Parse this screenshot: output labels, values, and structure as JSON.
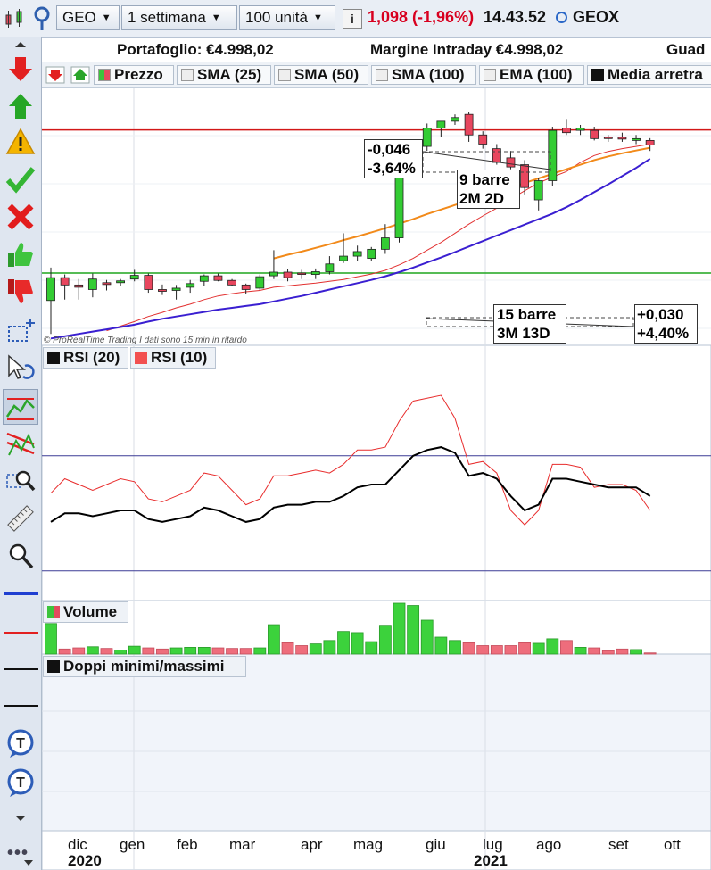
{
  "topbar": {
    "symbol": "GEO",
    "timeframe": "1 settimana",
    "units": "100 unità",
    "price_change": "1,098 (-1,96%)",
    "time": "14.43.52",
    "ticker": "GEOX"
  },
  "account": {
    "portfolio": "Portafoglio: €4.998,02",
    "margin": "Margine Intraday €4.998,02",
    "gain": "Guad"
  },
  "legend": {
    "price": "Prezzo",
    "sma25": "SMA (25)",
    "sma50": "SMA (50)",
    "sma100": "SMA (100)",
    "ema100": "EMA (100)",
    "media": "Media arretra"
  },
  "annotations": {
    "box1_line1": "-0,046",
    "box1_line2": "-3,64%",
    "box2_line1": "9 barre",
    "box2_line2": "2M 2D",
    "box3_line1": "15 barre",
    "box3_line2": "3M 13D",
    "box4_line1": "+0,030",
    "box4_line2": "+4,40%",
    "watermark": "© ProRealTime Trading  I dati sono 15 min in ritardo"
  },
  "panels": {
    "rsi20": "RSI (20)",
    "rsi10": "RSI (10)",
    "volume": "Volume",
    "doppi": "Doppi minimi/massimi"
  },
  "xaxis": {
    "months": [
      "dic",
      "gen",
      "feb",
      "mar",
      "apr",
      "mag",
      "giu",
      "lug",
      "ago",
      "set",
      "ott"
    ],
    "year_2020": "2020",
    "year_2021": "2021"
  },
  "colors": {
    "bull": "#33cc33",
    "bear": "#e8465e",
    "sma_red": "#e23030",
    "sma_orange": "#f28a1a",
    "sma_blue": "#3a1fd1",
    "rsi20": "#000000",
    "rsi10": "#e82c2c",
    "hline_red": "#d21818",
    "hline_green": "#1fa51f"
  },
  "chart_data": {
    "type": "candlestick",
    "interval": "1 settimana",
    "candles": [
      {
        "o": 0.878,
        "h": 0.95,
        "l": 0.805,
        "c": 0.928
      },
      {
        "o": 0.928,
        "h": 0.935,
        "l": 0.88,
        "c": 0.912
      },
      {
        "o": 0.912,
        "h": 0.925,
        "l": 0.88,
        "c": 0.907
      },
      {
        "o": 0.902,
        "h": 0.937,
        "l": 0.885,
        "c": 0.925
      },
      {
        "o": 0.917,
        "h": 0.923,
        "l": 0.9,
        "c": 0.913
      },
      {
        "o": 0.917,
        "h": 0.925,
        "l": 0.91,
        "c": 0.921
      },
      {
        "o": 0.925,
        "h": 0.945,
        "l": 0.92,
        "c": 0.933
      },
      {
        "o": 0.933,
        "h": 0.937,
        "l": 0.895,
        "c": 0.902
      },
      {
        "o": 0.902,
        "h": 0.913,
        "l": 0.89,
        "c": 0.898
      },
      {
        "o": 0.9,
        "h": 0.912,
        "l": 0.88,
        "c": 0.905
      },
      {
        "o": 0.907,
        "h": 0.923,
        "l": 0.895,
        "c": 0.915
      },
      {
        "o": 0.92,
        "h": 0.935,
        "l": 0.91,
        "c": 0.932
      },
      {
        "o": 0.932,
        "h": 0.937,
        "l": 0.92,
        "c": 0.922
      },
      {
        "o": 0.922,
        "h": 0.925,
        "l": 0.91,
        "c": 0.912
      },
      {
        "o": 0.912,
        "h": 0.915,
        "l": 0.892,
        "c": 0.902
      },
      {
        "o": 0.905,
        "h": 0.935,
        "l": 0.9,
        "c": 0.93
      },
      {
        "o": 0.932,
        "h": 0.988,
        "l": 0.925,
        "c": 0.94
      },
      {
        "o": 0.94,
        "h": 0.947,
        "l": 0.92,
        "c": 0.928
      },
      {
        "o": 0.938,
        "h": 0.945,
        "l": 0.925,
        "c": 0.935
      },
      {
        "o": 0.935,
        "h": 0.948,
        "l": 0.925,
        "c": 0.941
      },
      {
        "o": 0.941,
        "h": 0.975,
        "l": 0.935,
        "c": 0.958
      },
      {
        "o": 0.965,
        "h": 1.025,
        "l": 0.96,
        "c": 0.975
      },
      {
        "o": 0.975,
        "h": 0.998,
        "l": 0.965,
        "c": 0.985
      },
      {
        "o": 0.97,
        "h": 0.995,
        "l": 0.965,
        "c": 0.99
      },
      {
        "o": 0.99,
        "h": 1.045,
        "l": 0.98,
        "c": 1.015
      },
      {
        "o": 1.015,
        "h": 1.18,
        "l": 1.005,
        "c": 1.16
      },
      {
        "o": 1.16,
        "h": 1.225,
        "l": 1.15,
        "c": 1.21
      },
      {
        "o": 1.215,
        "h": 1.265,
        "l": 1.205,
        "c": 1.255
      },
      {
        "o": 1.255,
        "h": 1.27,
        "l": 1.235,
        "c": 1.27
      },
      {
        "o": 1.27,
        "h": 1.285,
        "l": 1.262,
        "c": 1.278
      },
      {
        "o": 1.285,
        "h": 1.29,
        "l": 1.225,
        "c": 1.24
      },
      {
        "o": 1.24,
        "h": 1.248,
        "l": 1.21,
        "c": 1.22
      },
      {
        "o": 1.21,
        "h": 1.22,
        "l": 1.175,
        "c": 1.18
      },
      {
        "o": 1.19,
        "h": 1.205,
        "l": 1.165,
        "c": 1.17
      },
      {
        "o": 1.175,
        "h": 1.185,
        "l": 1.11,
        "c": 1.125
      },
      {
        "o": 1.098,
        "h": 1.145,
        "l": 1.075,
        "c": 1.14
      },
      {
        "o": 1.14,
        "h": 1.258,
        "l": 1.128,
        "c": 1.25
      },
      {
        "o": 1.255,
        "h": 1.275,
        "l": 1.24,
        "c": 1.245
      },
      {
        "o": 1.25,
        "h": 1.262,
        "l": 1.24,
        "c": 1.255
      },
      {
        "o": 1.25,
        "h": 1.258,
        "l": 1.228,
        "c": 1.232
      },
      {
        "o": 1.235,
        "h": 1.24,
        "l": 1.225,
        "c": 1.233
      },
      {
        "o": 1.235,
        "h": 1.245,
        "l": 1.225,
        "c": 1.231
      },
      {
        "o": 1.228,
        "h": 1.24,
        "l": 1.22,
        "c": 1.232
      },
      {
        "o": 1.228,
        "h": 1.233,
        "l": 1.205,
        "c": 1.218
      }
    ],
    "sma_red": [
      null,
      null,
      null,
      null,
      0.812,
      0.822,
      0.832,
      0.843,
      0.852,
      0.862,
      0.87,
      0.88,
      0.888,
      0.893,
      0.897,
      0.9,
      0.907,
      0.91,
      0.913,
      0.916,
      0.92,
      0.924,
      0.93,
      0.936,
      0.944,
      0.956,
      0.97,
      0.988,
      1.005,
      1.025,
      1.045,
      1.063,
      1.08,
      1.1,
      1.118,
      1.135,
      1.148,
      1.16,
      1.18,
      1.195,
      1.204,
      1.21,
      1.215,
      1.22
    ],
    "sma_orange": [
      null,
      null,
      null,
      null,
      null,
      null,
      null,
      null,
      null,
      null,
      null,
      null,
      null,
      null,
      null,
      null,
      0.97,
      0.978,
      0.985,
      0.993,
      1.001,
      1.01,
      1.018,
      1.027,
      1.036,
      1.046,
      1.056,
      1.067,
      1.077,
      1.087,
      1.096,
      1.106,
      1.116,
      1.125,
      1.135,
      1.145,
      1.155,
      1.165,
      1.175,
      1.185,
      1.193,
      1.2,
      1.206,
      1.212
    ],
    "sma_blue": [
      0.795,
      0.8,
      0.805,
      0.81,
      0.815,
      0.82,
      0.825,
      0.832,
      0.838,
      0.843,
      0.848,
      0.853,
      0.858,
      0.862,
      0.866,
      0.87,
      0.876,
      0.882,
      0.888,
      0.895,
      0.902,
      0.909,
      0.916,
      0.923,
      0.931,
      0.94,
      0.95,
      0.961,
      0.972,
      0.984,
      0.996,
      1.008,
      1.02,
      1.032,
      1.044,
      1.056,
      1.068,
      1.082,
      1.098,
      1.115,
      1.132,
      1.15,
      1.168,
      1.188
    ],
    "hline_red": 1.251,
    "hline_green": 0.938,
    "rsi20": [
      47,
      50,
      50,
      49,
      50,
      51,
      51,
      48,
      47,
      48,
      49,
      52,
      51,
      49,
      47,
      48,
      52,
      53,
      53,
      54,
      54,
      56,
      59,
      60,
      60,
      65,
      70,
      72,
      73,
      71,
      63,
      64,
      62,
      56,
      51,
      53,
      62,
      62,
      61,
      60,
      59,
      59,
      59,
      56
    ],
    "rsi10": [
      57,
      62,
      60,
      58,
      60,
      62,
      61,
      55,
      54,
      56,
      58,
      64,
      63,
      58,
      53,
      55,
      63,
      63,
      64,
      65,
      64,
      67,
      72,
      72,
      73,
      82,
      89,
      90,
      91,
      83,
      67,
      68,
      64,
      51,
      46,
      51,
      67,
      67,
      66,
      59,
      60,
      60,
      58,
      51
    ],
    "rsi_levels": [
      70,
      30
    ],
    "volume": [
      54,
      9,
      11,
      13,
      10,
      7,
      14,
      11,
      9,
      11,
      12,
      12,
      11,
      10,
      10,
      11,
      52,
      20,
      15,
      18,
      24,
      40,
      38,
      22,
      51,
      90,
      86,
      60,
      30,
      24,
      20,
      15,
      15,
      15,
      20,
      19,
      27,
      24,
      12,
      11,
      6,
      9,
      8,
      2
    ],
    "x_months": [
      "dic",
      "gen",
      "feb",
      "mar",
      "apr",
      "mag",
      "giu",
      "lug",
      "ago",
      "set",
      "ott"
    ]
  }
}
